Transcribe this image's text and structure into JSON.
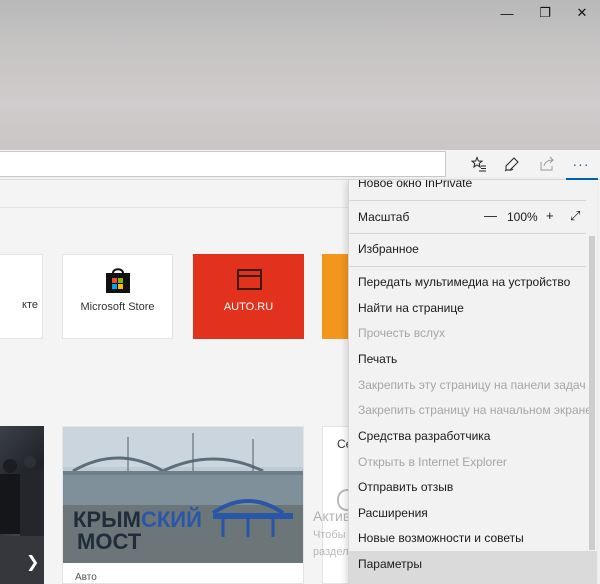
{
  "window": {
    "minimize": "—",
    "restore": "❐",
    "close": "✕"
  },
  "toolbar": {
    "favorites_icon": "star-lines-icon",
    "notes_icon": "pen-icon",
    "share_icon": "share-icon",
    "more_label": "···"
  },
  "tiles": [
    {
      "label": "кте"
    },
    {
      "label": "Microsoft Store"
    },
    {
      "label": "AUTO.RU"
    }
  ],
  "news": {
    "card_category": "Авто",
    "right_card_title": "Се",
    "photo_text_line1_a": "КРЫМ",
    "photo_text_line1_b": "СКИЙ",
    "photo_text_line2": "МОСТ"
  },
  "menu": {
    "top_partial": "Новое окно InPrivate",
    "zoom_label": "Масштаб",
    "zoom_minus": "—",
    "zoom_value": "100%",
    "zoom_plus": "+",
    "zoom_fullscreen": "⤢",
    "items": [
      {
        "label": "Избранное",
        "disabled": false
      },
      {
        "label": "Передать мультимедиа на устройство",
        "disabled": false
      },
      {
        "label": "Найти на странице",
        "disabled": false
      },
      {
        "label": "Прочесть вслух",
        "disabled": true
      },
      {
        "label": "Печать",
        "disabled": false
      },
      {
        "label": "Закрепить эту страницу на панели задач",
        "disabled": true
      },
      {
        "label": "Закрепить страницу на начальном экране",
        "disabled": true
      },
      {
        "label": "Средства разработчика",
        "disabled": false
      },
      {
        "label": "Открыть в Internet Explorer",
        "disabled": true
      },
      {
        "label": "Отправить отзыв",
        "disabled": false
      },
      {
        "label": "Расширения",
        "disabled": false
      },
      {
        "label": "Новые возможности и советы",
        "disabled": false
      },
      {
        "label": "Параметры",
        "disabled": false
      }
    ]
  },
  "watermark": {
    "title": "Активация Windows",
    "line1": "Чтобы активировать Windows, перейдите в",
    "line2": "раздел \"Параметры\"."
  },
  "colors": {
    "accent": "#0063b1",
    "auto_tile": "#e2321e",
    "orange_tile": "#f3961e"
  }
}
